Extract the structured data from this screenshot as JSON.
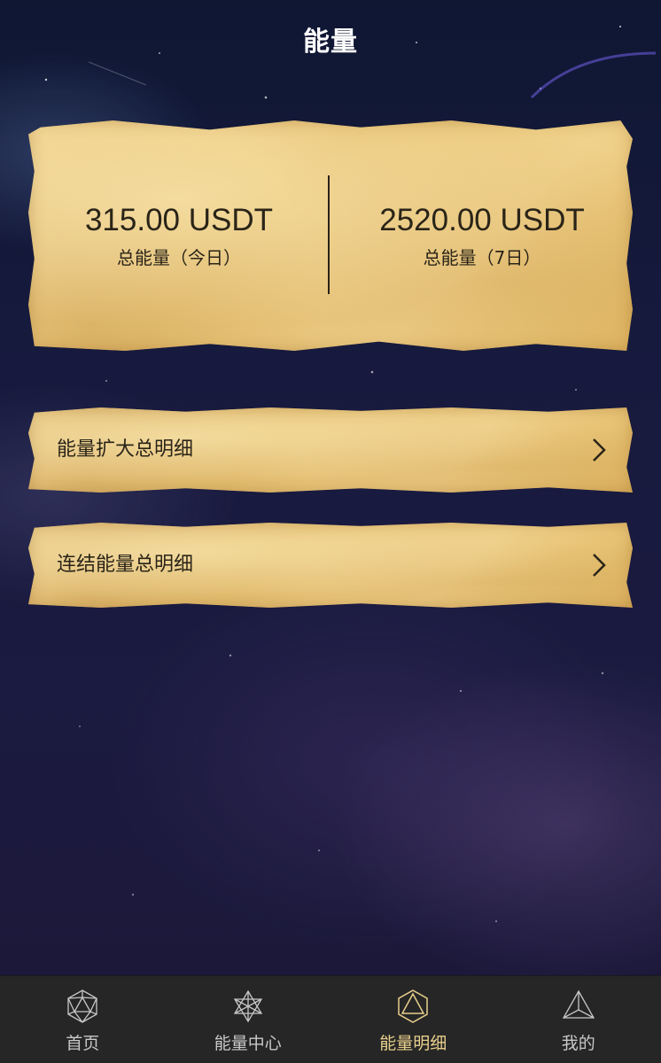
{
  "header": {
    "title": "能量"
  },
  "summary": {
    "today": {
      "amount": "315.00 USDT",
      "label": "总能量（今日）"
    },
    "week": {
      "amount": "2520.00 USDT",
      "label": "总能量（7日）"
    }
  },
  "rows": [
    {
      "label": "能量扩大总明细"
    },
    {
      "label": "连结能量总明细"
    }
  ],
  "tabbar": {
    "active_index": 2,
    "items": [
      {
        "label": "首页",
        "icon": "icosahedron-icon"
      },
      {
        "label": "能量中心",
        "icon": "merkaba-icon"
      },
      {
        "label": "能量明细",
        "icon": "octahedron-icon"
      },
      {
        "label": "我的",
        "icon": "tetrahedron-icon"
      }
    ]
  },
  "colors": {
    "parchment": "#f0d28c",
    "text_dark": "#2a2418",
    "tabbar_bg": "#262626",
    "tab_active": "#e8cf8c",
    "tab_inactive": "#c8c8c8"
  }
}
